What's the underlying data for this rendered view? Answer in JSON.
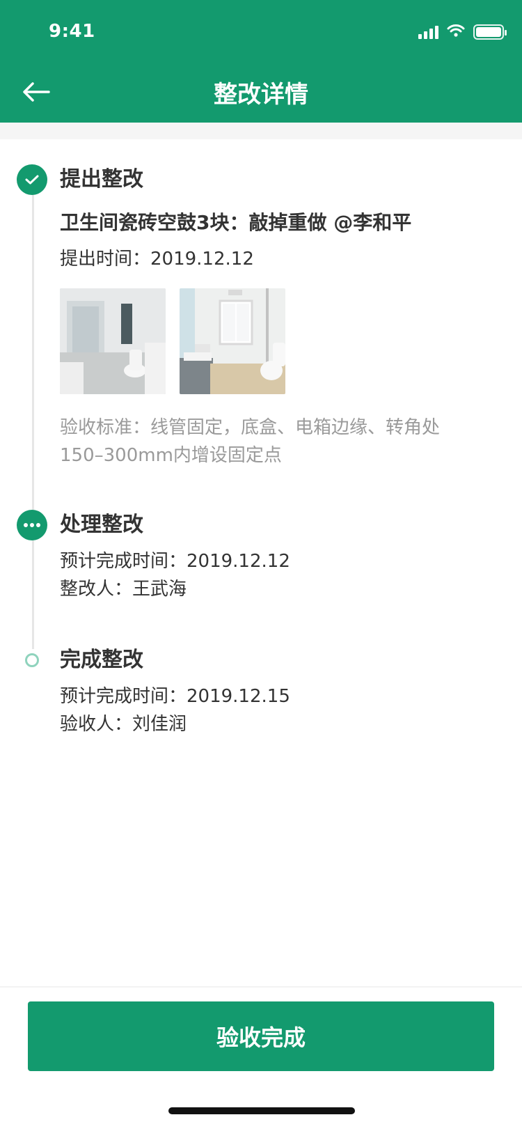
{
  "status_bar": {
    "time": "9:41"
  },
  "header": {
    "title": "整改详情"
  },
  "timeline": [
    {
      "title": "提出整改",
      "description": "卫生间瓷砖空鼓3块：敲掉重做 @李和平",
      "time_line": "提出时间：2019.12.12",
      "photos": [
        "bathroom-photo-1",
        "bathroom-photo-2"
      ],
      "standard": "验收标准：线管固定，底盒、电箱边缘、转角处150–300mm内增设固定点"
    },
    {
      "title": "处理整改",
      "lines": [
        "预计完成时间：2019.12.12",
        "整改人：王武海"
      ]
    },
    {
      "title": "完成整改",
      "lines": [
        "预计完成时间：2019.12.15",
        "验收人：刘佳润"
      ]
    }
  ],
  "actions": {
    "primary_button": "验收完成"
  },
  "colors": {
    "brand": "#139a6e",
    "muted_text": "#9a9a9a",
    "text": "#333333"
  },
  "icons": [
    "back-arrow-icon",
    "check-icon",
    "ellipsis-icon",
    "pending-dot-icon",
    "signal-icon",
    "wifi-icon",
    "battery-icon"
  ]
}
